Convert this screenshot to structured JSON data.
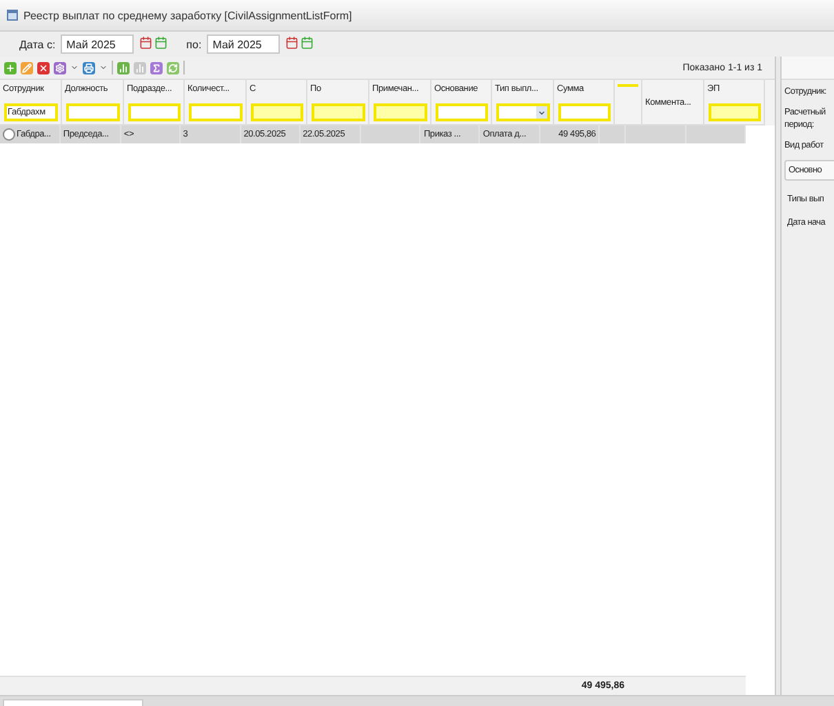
{
  "window": {
    "title": "Реестр выплат по среднему заработку [CivilAssignmentListForm]"
  },
  "date_filter": {
    "from_label": "Дата с:",
    "from_value": "Май 2025",
    "to_label": "по:",
    "to_value": "Май 2025"
  },
  "pager": "Показано 1-1 из 1",
  "table": {
    "columns": [
      {
        "label": "Сотрудник",
        "filter": {
          "kind": "text",
          "value": "Габдрахм",
          "highlighted": false
        }
      },
      {
        "label": "Должность",
        "filter": {
          "kind": "text",
          "highlighted": false
        }
      },
      {
        "label": "Подразде...",
        "filter": {
          "kind": "text",
          "highlighted": false
        }
      },
      {
        "label": "Количест...",
        "filter": {
          "kind": "text",
          "highlighted": false
        }
      },
      {
        "label": "С",
        "filter": {
          "kind": "text",
          "highlighted": true
        }
      },
      {
        "label": "По",
        "filter": {
          "kind": "text",
          "highlighted": true
        }
      },
      {
        "label": "Примечан...",
        "filter": {
          "kind": "text",
          "highlighted": true
        }
      },
      {
        "label": "Основание",
        "filter": {
          "kind": "text",
          "highlighted": false
        }
      },
      {
        "label": "Тип выпл...",
        "filter": {
          "kind": "combo",
          "highlighted": false
        }
      },
      {
        "label": "Сумма",
        "filter": {
          "kind": "text",
          "highlighted": false
        }
      },
      {
        "kind": "marker"
      },
      {
        "label": "Коммента..."
      },
      {
        "label": "ЭП",
        "filter": {
          "kind": "text",
          "highlighted": true
        }
      }
    ],
    "rows": [
      {
        "selected": true,
        "cells": [
          "Габдра...",
          "Председа...",
          "<>",
          "3",
          "20.05.2025",
          "22.05.2025",
          "",
          "Приказ ...",
          "Оплата д...",
          "49 495,86",
          "",
          "",
          ""
        ]
      }
    ],
    "total": "49 495,86"
  },
  "details": {
    "labels": [
      "Сотрудник:",
      "Расчетный период:",
      "Вид работ"
    ],
    "tab": "Основно",
    "fields": [
      "Типы вып",
      "Дата нача"
    ]
  }
}
